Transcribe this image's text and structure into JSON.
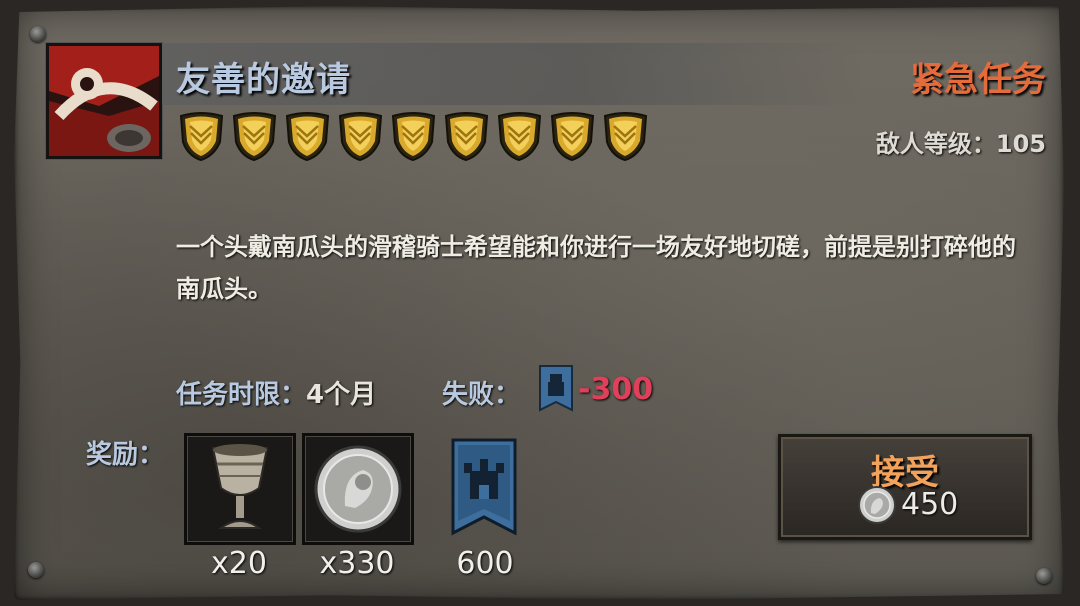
{
  "quest": {
    "title": "友善的邀请",
    "type_label": "紧急任务",
    "enemy_level_label": "敌人等级：",
    "enemy_level": "105",
    "difficulty_stars": 9,
    "description": "一个头戴南瓜头的滑稽骑士希望能和你进行一场友好地切磋，前提是别打碎他的南瓜头。"
  },
  "time_limit": {
    "label": "任务时限：",
    "value": "4个月"
  },
  "failure": {
    "label": "失败：",
    "penalty": "-300",
    "icon": "guild-banner-icon"
  },
  "rewards": {
    "label": "奖励：",
    "items": [
      {
        "icon": "goblet-icon",
        "qty": "x20"
      },
      {
        "icon": "silver-coin-icon",
        "qty": "x330"
      },
      {
        "icon": "guild-banner-icon",
        "qty": "600"
      }
    ]
  },
  "accept_button": {
    "label": "接受",
    "cost": "450",
    "cost_icon": "silver-coin-icon"
  },
  "colors": {
    "title": "#b8c9e0",
    "urgent": "#e56b3a",
    "penalty": "#e0405a",
    "accept": "#f2a25a"
  }
}
